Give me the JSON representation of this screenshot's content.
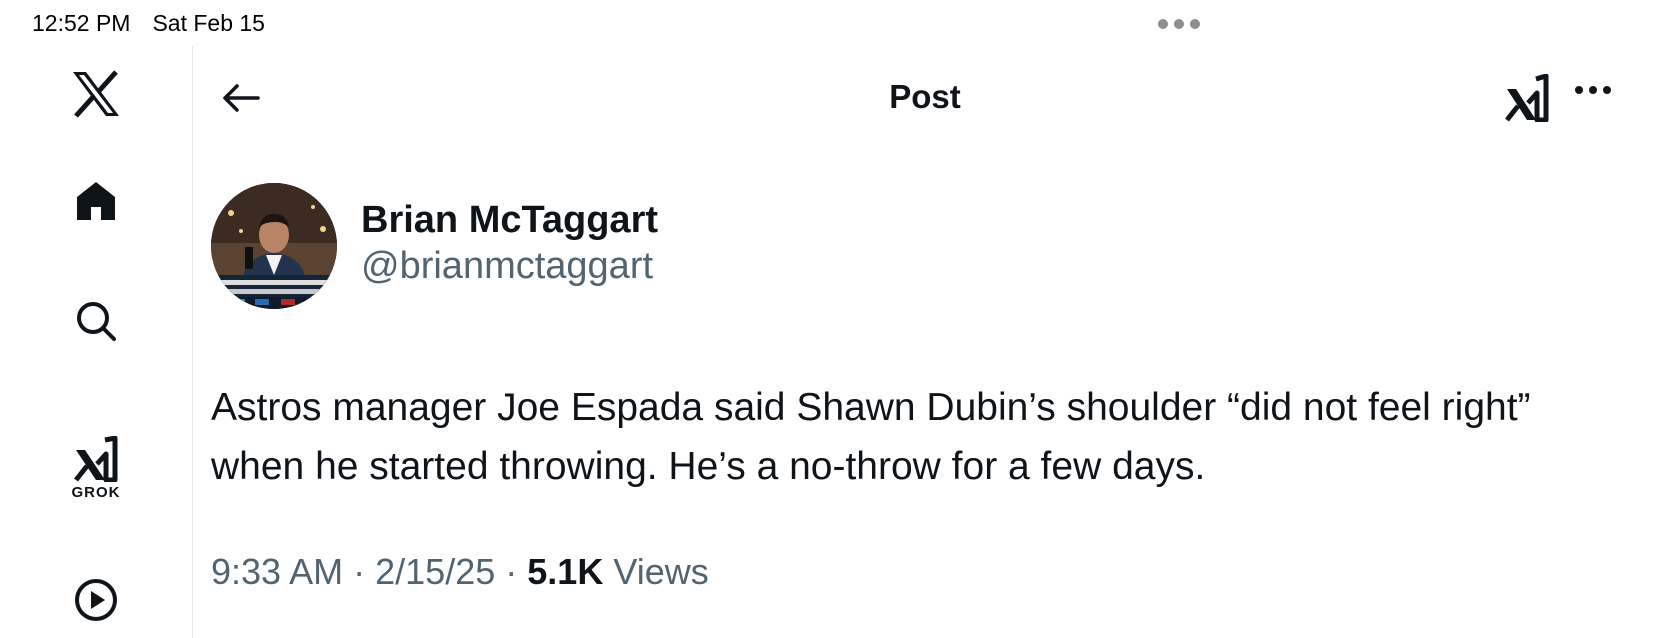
{
  "status_bar": {
    "time": "12:52 PM",
    "date": "Sat Feb 15"
  },
  "sidebar": {
    "items": [
      {
        "name": "x-logo-icon"
      },
      {
        "name": "home-icon"
      },
      {
        "name": "search-icon"
      },
      {
        "name": "grok-icon",
        "label": "GROK"
      },
      {
        "name": "play-icon"
      }
    ]
  },
  "header": {
    "title": "Post"
  },
  "post": {
    "author_name": "Brian McTaggart",
    "author_handle": "@brianmctaggart",
    "text": "Astros manager Joe Espada said Shawn Dubin’s shoulder “did not feel right” when he started throwing. He’s a no-throw for a few days.",
    "time": "9:33 AM",
    "date": "2/15/25",
    "views_count": "5.1K",
    "views_label": "Views",
    "separator": "·"
  },
  "colors": {
    "text_primary": "#0f1419",
    "text_secondary": "#536471",
    "divider": "#e6e9ec"
  }
}
